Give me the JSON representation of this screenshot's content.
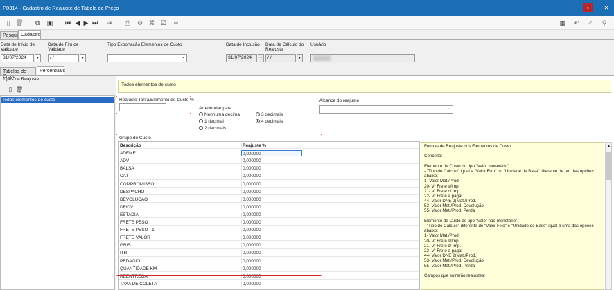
{
  "window": {
    "title": "P0314 - Cadastro de Reajuste de Tabela de Preço"
  },
  "main_tabs": [
    "Pesquisa",
    "Cadastro"
  ],
  "header_fields": [
    {
      "label": "Data de Início de\nValidade",
      "value": "31/07/2024"
    },
    {
      "label": "Data de Fim de\nValidade",
      "value": "/  /"
    },
    {
      "label": "Tipo Exportação Elementos de Custo",
      "value": ""
    },
    {
      "label": "Data de Inclusão",
      "value": "31/07/2024"
    },
    {
      "label": "Data de Cálculo do\nReajuste",
      "value": "/  /"
    },
    {
      "label": "Usuário",
      "value": ""
    }
  ],
  "sub_tabs": [
    "Tabelas de Preço",
    "Percentuais"
  ],
  "left_panel": {
    "title": "Tipos de Reajuste",
    "selected": "Todos elementos de custo"
  },
  "yellow_title": "Todos elementos de custo",
  "reajuste_label": "Reajuste Tarifa/Elemento de Custo %",
  "arredondar": {
    "label": "Arredondar para",
    "options": [
      "Nenhuma decimal",
      "1 decimal",
      "2 decimais",
      "3 decimais",
      "4 decimais"
    ],
    "selected": "4 decimais"
  },
  "alcance_label": "Alcance do reajuste",
  "grupo_label": "Grupo de Custo",
  "grid": {
    "headers": [
      "Descrição",
      "Reajuste %"
    ],
    "rows": [
      [
        "ADEME",
        "0,000000"
      ],
      [
        "ADV",
        "0,000000"
      ],
      [
        "BALSA",
        "0,000000"
      ],
      [
        "CAT",
        "0,000000"
      ],
      [
        "COMPROMISSO",
        "0,000000"
      ],
      [
        "DESPACHO",
        "0,000000"
      ],
      [
        "DEVOLUCAO",
        "0,000000"
      ],
      [
        "DF/DV",
        "0,000000"
      ],
      [
        "ESTADIA",
        "0,000000"
      ],
      [
        "FRETE PESO",
        "0,000000"
      ],
      [
        "FRETE PESO - 1",
        "0,000000"
      ],
      [
        "FRETE VALOR",
        "0,000000"
      ],
      [
        "GRIS",
        "0,000000"
      ],
      [
        "ITR",
        "0,000000"
      ],
      [
        "PEDAGIO",
        "0,000000"
      ],
      [
        "QUANTIDADE KM",
        "0,000000"
      ],
      [
        "REENTREGA",
        "0,000000"
      ],
      [
        "TAXA DE COLETA",
        "0,000000"
      ]
    ]
  },
  "info_lines": [
    "Formas de Reajuste dos Elementos de Custo",
    "",
    "Conceito:",
    "",
    "Elemento de Custo do tipo \"Valor monetário\":",
    "- \"Tipo de Cálculo\" igual a \"Valor Fixo\" ou \"Unidade de Base\" diferente de um das opções",
    "abaixo:",
    "1- Valor Mat./Prod.",
    "20- Vr Frete s/Imp.",
    "21- Vr Frete c/ Imp.",
    "22- Vr Frete a pagar",
    "44- Valor DNE 2(Mat./Prod.)",
    "53- Valor Mat./Prod. Devolução",
    "55- Valor Mat./Prod. Perda",
    "",
    "Elemento de Custo do tipo \"Valor não monetário\":",
    "- \"Tipo de Cálculo\" diferente de \"Valor Fixo\" e \"Unidade de Base\" igual a uma das opções",
    "abaixo:",
    "1- Valor Mat./Prod.",
    "20- Vr Frete s/Imp.",
    "21- Vr Frete c/ Imp.",
    "22- Vr Frete a pagar",
    "44- Valor DNE 2(Mat./Prod.)",
    "53- Valor Mat./Prod. Devolução",
    "55- Valor Mat./Prod. Perda",
    "",
    "Campos que sofrerão reajustes:"
  ]
}
